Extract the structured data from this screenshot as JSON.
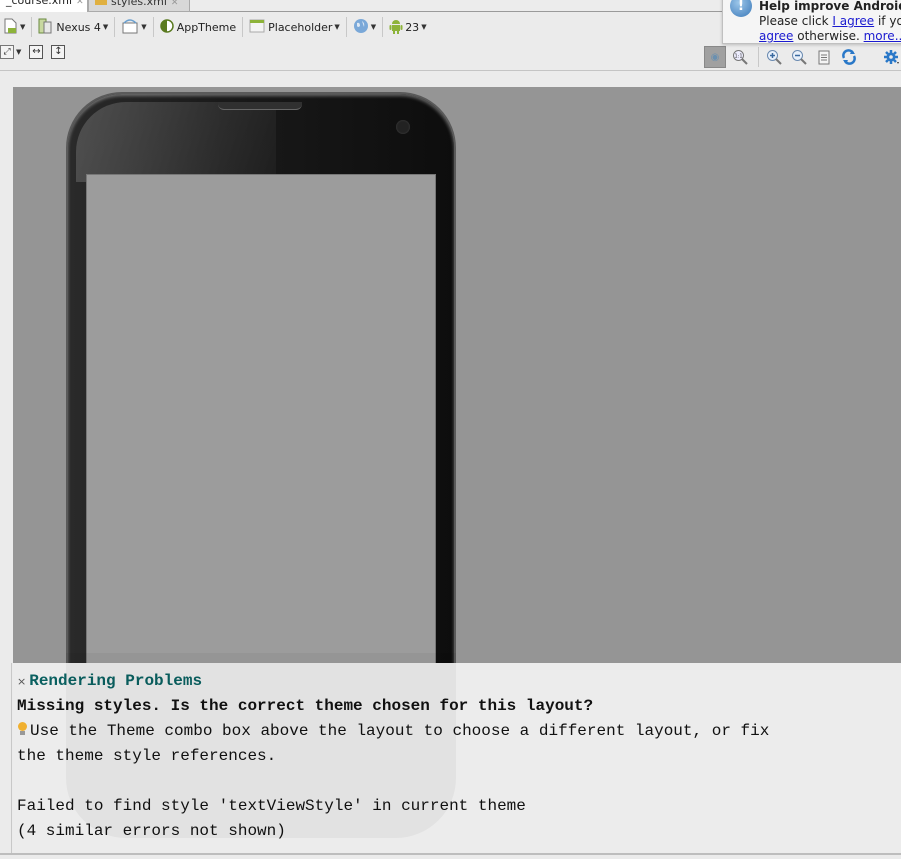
{
  "tabs": [
    {
      "label": "_course.xml",
      "active": true
    },
    {
      "label": "styles.xml",
      "active": false
    }
  ],
  "toolbar": {
    "device_label": "Nexus 4",
    "theme_label": "AppTheme",
    "activity_label": "Placeholder",
    "api_label": "23",
    "icons": {
      "new_config": "new-document-android-icon",
      "device": "device-icon",
      "orientation": "rotate-screen-icon",
      "theme": "theme-icon",
      "activity": "activity-icon",
      "locale": "globe-icon",
      "api": "android-icon"
    },
    "row2": {
      "zoom_fit": "expand-icon",
      "fit_width": "fit-width-icon",
      "fit_height": "fit-height-icon"
    },
    "right": {
      "zoom_to_fit": "zoom-fit-icon",
      "actual_size": "zoom-actual-size-icon",
      "zoom_in": "zoom-in-icon",
      "zoom_out": "zoom-out-icon",
      "screenshot": "document-icon",
      "refresh": "refresh-icon",
      "settings": "gear-icon"
    }
  },
  "notification": {
    "title": "Help improve Android S",
    "line1_prefix": "Please click ",
    "agree_link": "I agree",
    "line1_suffix": " if you",
    "disagree_link": "agree",
    "line2_suffix": " otherwise. ",
    "more_link": "more..."
  },
  "problems": {
    "close_glyph": "×",
    "title": "Rendering Problems",
    "headline": "Missing styles. Is the correct theme chosen for this layout?",
    "hint_line1": "Use the Theme combo box above the layout to choose a different layout, or fix",
    "hint_line2": "the theme style references.",
    "error_line": "Failed to find style 'textViewStyle' in current theme",
    "suppressed": "(4 similar errors not shown)"
  },
  "colors": {
    "canvas_bg": "#959595",
    "problems_title": "#0a6060",
    "link": "#1a1ad0"
  }
}
